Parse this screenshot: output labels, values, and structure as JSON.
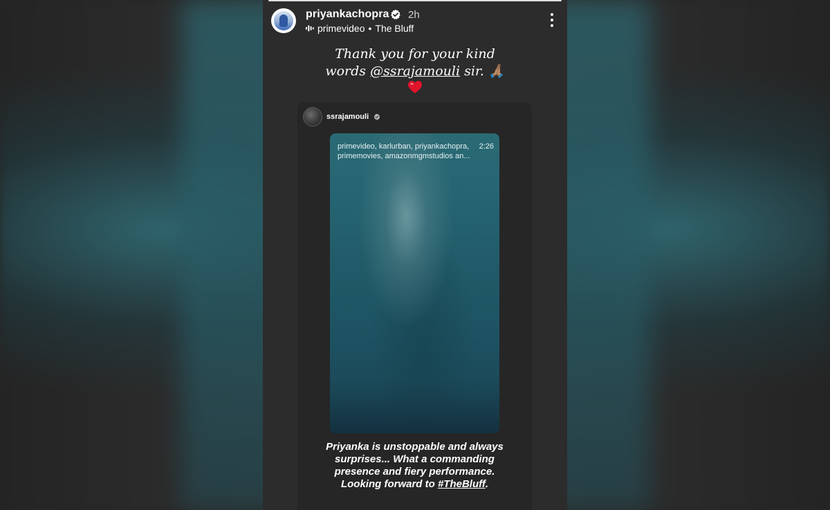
{
  "story": {
    "username": "priyankachopra",
    "time": "2h",
    "audio_account": "primevideo",
    "separator": "•",
    "audio_title": "The Bluff",
    "caption": {
      "line1": "Thank you for your kind",
      "line2_prefix": "words",
      "mention": "@ssrajamouli",
      "line2_suffix": "sir. 🙏🏽"
    }
  },
  "reshared_post": {
    "username": "ssrajamouli",
    "embed": {
      "line1_accounts": "primevideo, karlurban, priyankachopra,",
      "duration": "2:26",
      "line2_accounts": "primemovies, amazonmgmstudios an..."
    },
    "quote": {
      "line1": "Priyanka is unstoppable and always",
      "line2": "surprises... What a commanding",
      "line3": "presence and fiery performance.",
      "line4_prefix": "Looking forward to",
      "hashtag": "#TheBluff",
      "line4_suffix": "."
    }
  },
  "colors": {
    "verified_blue": "#3897f0",
    "heart_red": "#e0142b",
    "story_bg": "#2c2c2c",
    "teal": "#256573"
  },
  "icons": [
    "verified-icon",
    "audio-icon",
    "more-icon",
    "heart-icon"
  ]
}
